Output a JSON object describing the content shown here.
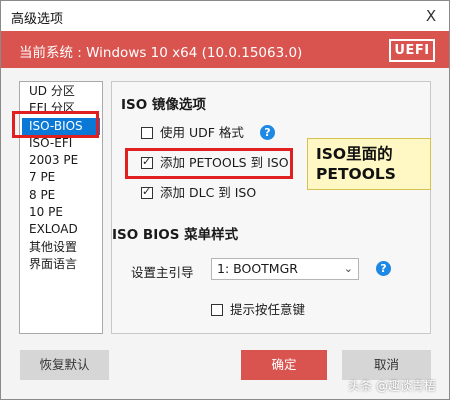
{
  "window": {
    "title": "高级选项",
    "close_glyph": "X"
  },
  "banner": {
    "system_text": "当前系统 : Windows 10 x64 (10.0.15063.0)",
    "badge": "UEFI"
  },
  "sidebar": {
    "items": [
      {
        "label": "UD 分区"
      },
      {
        "label": "EFI 分区"
      },
      {
        "label": "ISO-BIOS",
        "selected": true
      },
      {
        "label": "ISO-EFI"
      },
      {
        "label": "2003 PE"
      },
      {
        "label": "7 PE"
      },
      {
        "label": "8 PE"
      },
      {
        "label": "10 PE"
      },
      {
        "label": "EXLOAD"
      },
      {
        "label": "其他设置"
      },
      {
        "label": "界面语言"
      }
    ]
  },
  "iso_section": {
    "title": "ISO 镜像选项",
    "options": [
      {
        "label": "使用 UDF 格式",
        "checked": false
      },
      {
        "label": "添加 PETOOLS 到 ISO",
        "checked": true
      },
      {
        "label": "添加 DLC 到 ISO",
        "checked": true
      }
    ]
  },
  "menu_section": {
    "title": "ISO BIOS 菜单样式",
    "bootloader_label": "设置主引导",
    "bootloader_value": "1: BOOTMGR",
    "show_key_label": "提示按任意键",
    "show_key_checked": false
  },
  "callout": {
    "line1": "ISO里面的",
    "line2": "PETOOLS"
  },
  "buttons": {
    "restore": "恢复默认",
    "ok": "确定",
    "cancel": "取消"
  },
  "watermark": "头条 @趣谈青梧",
  "icons": {
    "help": "help-circle-icon",
    "chevron": "chevron-down-icon",
    "check": "checkmark-icon"
  },
  "colors": {
    "accent_red": "#d9534f",
    "selection_blue": "#0a78d7",
    "help_blue": "#1e88e5",
    "highlight_red": "#e02020",
    "callout_bg": "#fff8c4"
  }
}
